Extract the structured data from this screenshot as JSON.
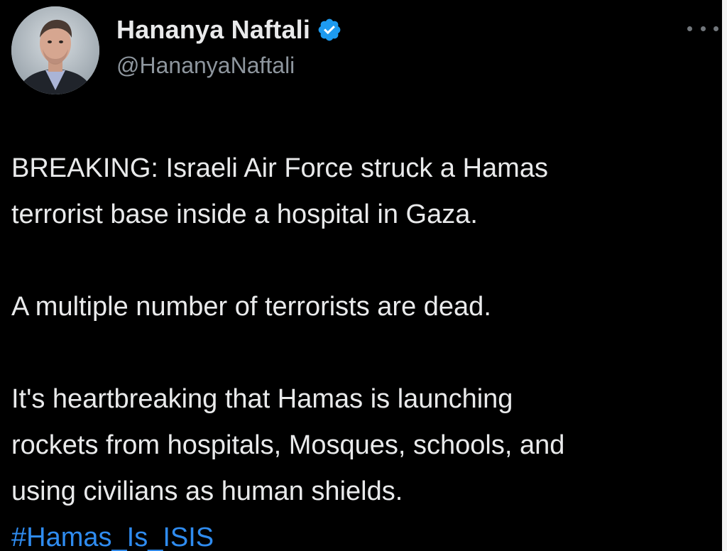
{
  "tweet": {
    "author": {
      "display_name": "Hananya Naftali",
      "handle": "@HananyaNaftali",
      "verified": true,
      "verified_icon": "verified-badge-icon",
      "avatar_icon": "profile-photo"
    },
    "more_icon": "more-options-icon",
    "paragraphs": [
      "BREAKING: Israeli Air Force struck a Hamas\nterrorist base inside a hospital in Gaza.",
      "A multiple number of terrorists are dead.",
      "It's heartbreaking that Hamas is launching\nrockets from hospitals, Mosques, schools, and\nusing civilians as human shields."
    ],
    "hashtag": "#Hamas_Is_ISIS"
  },
  "colors": {
    "background": "#000000",
    "text": "#e9eaeb",
    "secondary_text": "#8e969e",
    "accent_link": "#2f8cf0",
    "verified_badge": "#1d9bf0"
  }
}
